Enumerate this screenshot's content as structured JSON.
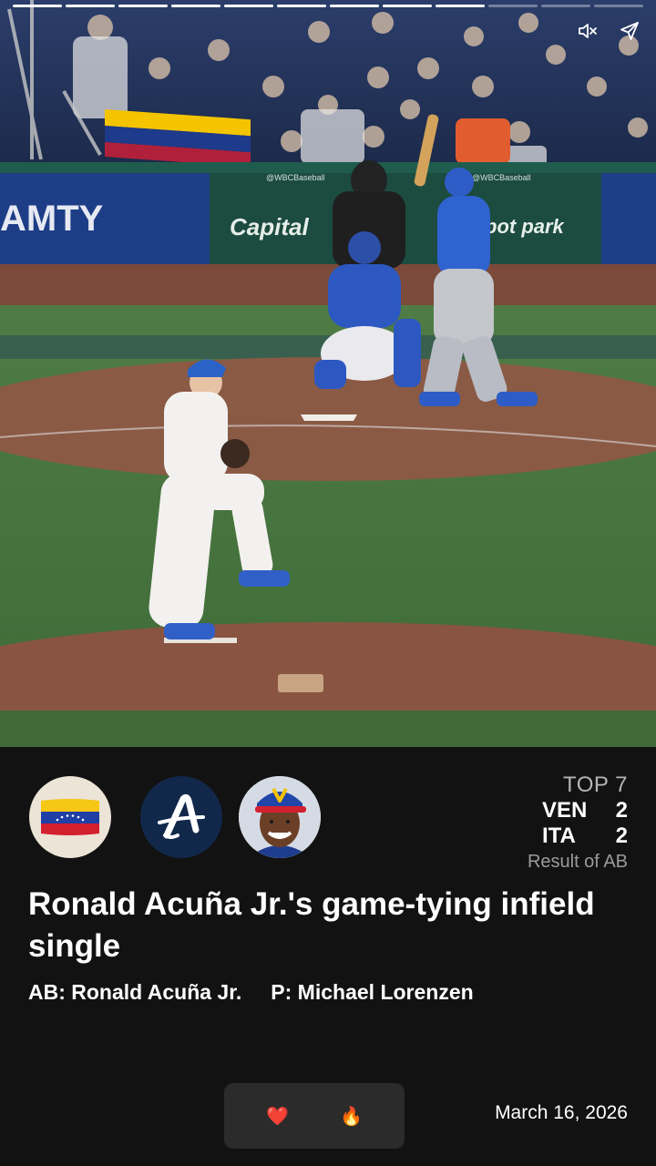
{
  "video": {
    "progress_segments": [
      {
        "state": "done"
      },
      {
        "state": "done"
      },
      {
        "state": "done"
      },
      {
        "state": "done"
      },
      {
        "state": "done"
      },
      {
        "state": "done"
      },
      {
        "state": "done"
      },
      {
        "state": "done"
      },
      {
        "state": "active"
      },
      {
        "state": "pending"
      },
      {
        "state": "pending"
      },
      {
        "state": "pending"
      }
    ],
    "mute_icon": "speaker-muted-icon",
    "share_icon": "send-icon",
    "scene_text": {
      "wall_left": "AMTY",
      "wall_center": "Capital",
      "wall_right": "pot park",
      "wall_tag_left": "@WBCBaseball",
      "wall_tag_right": "@WBCBaseball"
    }
  },
  "panel": {
    "logos": [
      {
        "name": "venezuela-flag-logo"
      },
      {
        "name": "braves-logo",
        "letter": "A"
      },
      {
        "name": "player-headshot"
      }
    ],
    "score": {
      "inning": "TOP 7",
      "teams": [
        {
          "abbr": "VEN",
          "runs": "2"
        },
        {
          "abbr": "ITA",
          "runs": "2"
        }
      ],
      "result_label": "Result of AB"
    },
    "headline": "Ronald Acuña Jr.'s game-tying infield single",
    "at_bat": "AB: Ronald Acuña Jr.",
    "pitcher": "P: Michael Lorenzen",
    "reactions": [
      {
        "name": "heart-reaction",
        "glyph": "❤️"
      },
      {
        "name": "fire-reaction",
        "glyph": "🔥"
      }
    ],
    "date": "March 16, 2026"
  },
  "colors": {
    "background": "#121212",
    "reaction_bg": "#2b2b2b",
    "muted_text": "#b5b5b5",
    "braves_navy": "#12284b"
  }
}
